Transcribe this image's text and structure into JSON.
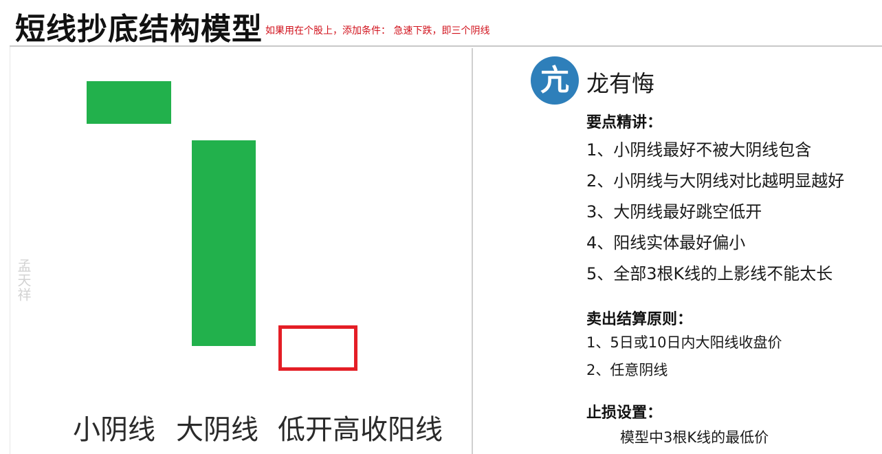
{
  "header": {
    "title": "短线抄底结构模型",
    "note": "如果用在个股上，添加条件： 急速下跌，即三个阴线"
  },
  "diagram": {
    "watermark": "孟天祥",
    "candles": [
      {
        "label": "小阴线",
        "kind": "bearish",
        "color": "#22b14c"
      },
      {
        "label": "大阴线",
        "kind": "bearish",
        "color": "#22b14c"
      },
      {
        "label": "低开高收阳线",
        "kind": "bullish",
        "color": "#e41e26"
      }
    ]
  },
  "panel": {
    "avatar_glyph": "亢",
    "author": "龙有悔",
    "key_points_title": "要点精讲：",
    "key_points": [
      "1、小阴线最好不被大阴线包含",
      "2、小阴线与大阴线对比越明显越好",
      "3、大阴线最好跳空低开",
      "4、阳线实体最好偏小",
      "5、全部3根K线的上影线不能太长"
    ],
    "sell_title": "卖出结算原则：",
    "sell_rules": [
      "1、5日或10日内大阳线收盘价",
      "2、任意阴线"
    ],
    "stop_title": "止损设置：",
    "stop_rule": "模型中3根K线的最低价"
  }
}
